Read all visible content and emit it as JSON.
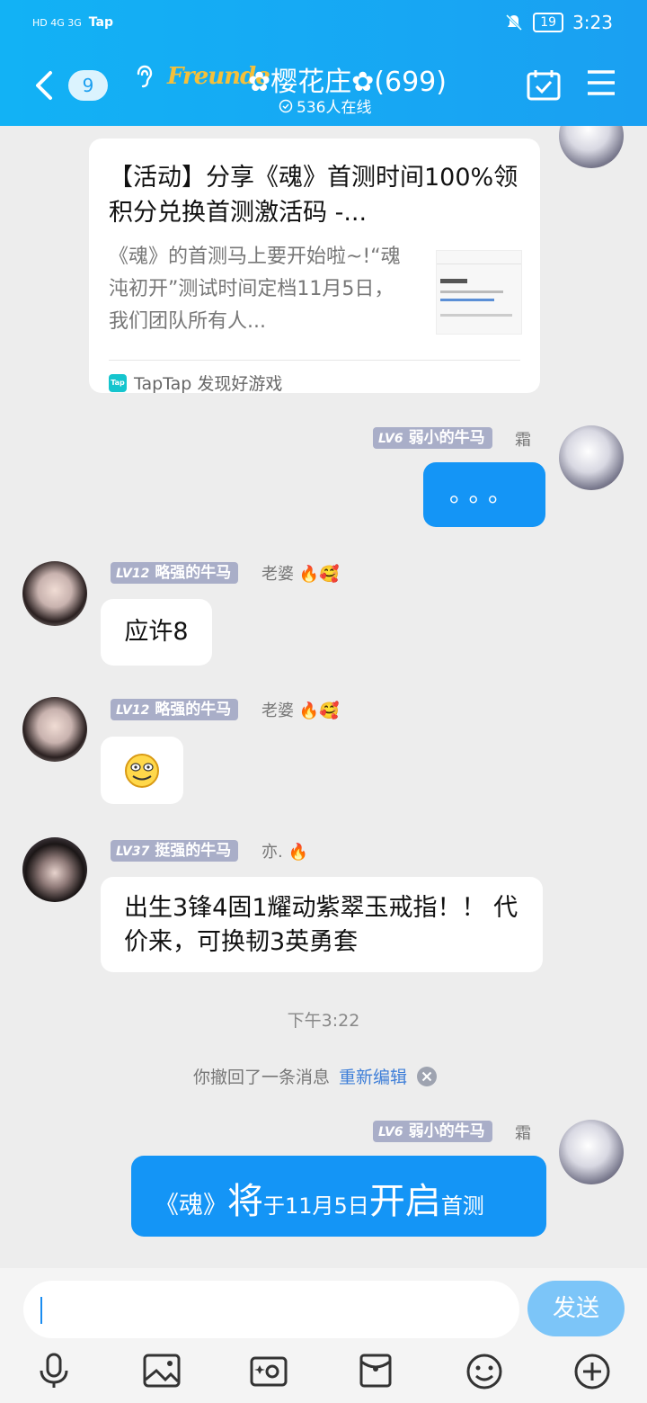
{
  "status_bar": {
    "left_text": "HD 4G 3G",
    "tap": "Tap",
    "battery": "19",
    "time": "3:23"
  },
  "header": {
    "unread_count": "9",
    "brand": "Freunde",
    "title": "✿樱花庄✿(699)",
    "online": "536人在线"
  },
  "messages": {
    "card": {
      "title": "【活动】分享《魂》首测时间100%领积分兑换首测激活码 -...",
      "desc": "《魂》的首测马上要开始啦~!“魂沌初开”测试时间定档11月5日，我们团队所有人...",
      "source": "TapTap 发现好游戏",
      "source_logo": "Tap"
    },
    "m1": {
      "level": "LV6",
      "name": "弱小的牛马",
      "nick": "霜",
      "text": "。。。"
    },
    "m2": {
      "level": "LV12",
      "name": "略强的牛马",
      "nick": "老婆",
      "text": "应许8"
    },
    "m3": {
      "level": "LV12",
      "name": "略强的牛马",
      "nick": "老婆",
      "text": ""
    },
    "m4": {
      "level": "LV37",
      "name": "挺强的牛马",
      "nick": "亦.",
      "text": "出生3锋4固1耀动紫翠玉戒指！！ 代价来，可换韧3英勇套"
    },
    "time": "下午3:22",
    "recall": {
      "text": "你撤回了一条消息",
      "action": "重新编辑"
    },
    "m5": {
      "level": "LV6",
      "name": "弱小的牛马",
      "nick": "霜",
      "parts": [
        "《魂》",
        "将",
        "于11月5日",
        "开启",
        "首测"
      ]
    }
  },
  "input": {
    "send": "发送"
  }
}
